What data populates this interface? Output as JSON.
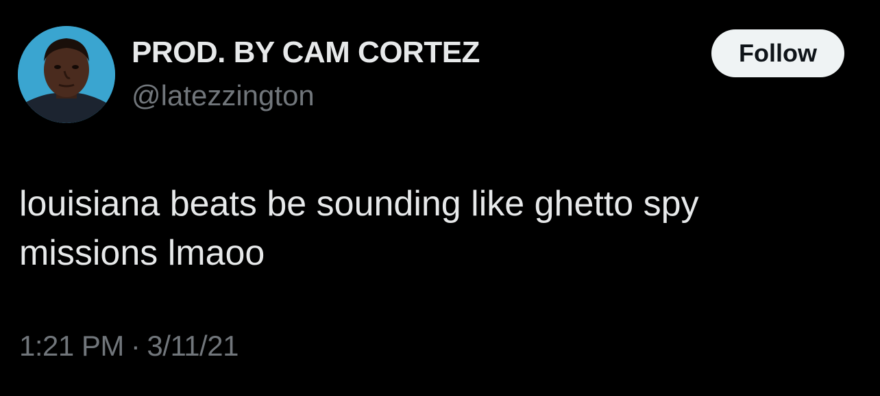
{
  "author": {
    "display_name": "PROD. BY CAM CORTEZ",
    "handle": "@latezzington",
    "avatar_icon": "profile-photo"
  },
  "follow_button": {
    "label": "Follow"
  },
  "tweet": {
    "text": "louisiana beats be sounding like ghetto spy missions lmaoo",
    "time": "1:21 PM",
    "separator": "·",
    "date": "3/11/21"
  },
  "colors": {
    "background": "#000000",
    "primary_text": "#e7e9ea",
    "secondary_text": "#71767b",
    "button_bg": "#eff3f4",
    "button_text": "#0f1419"
  }
}
